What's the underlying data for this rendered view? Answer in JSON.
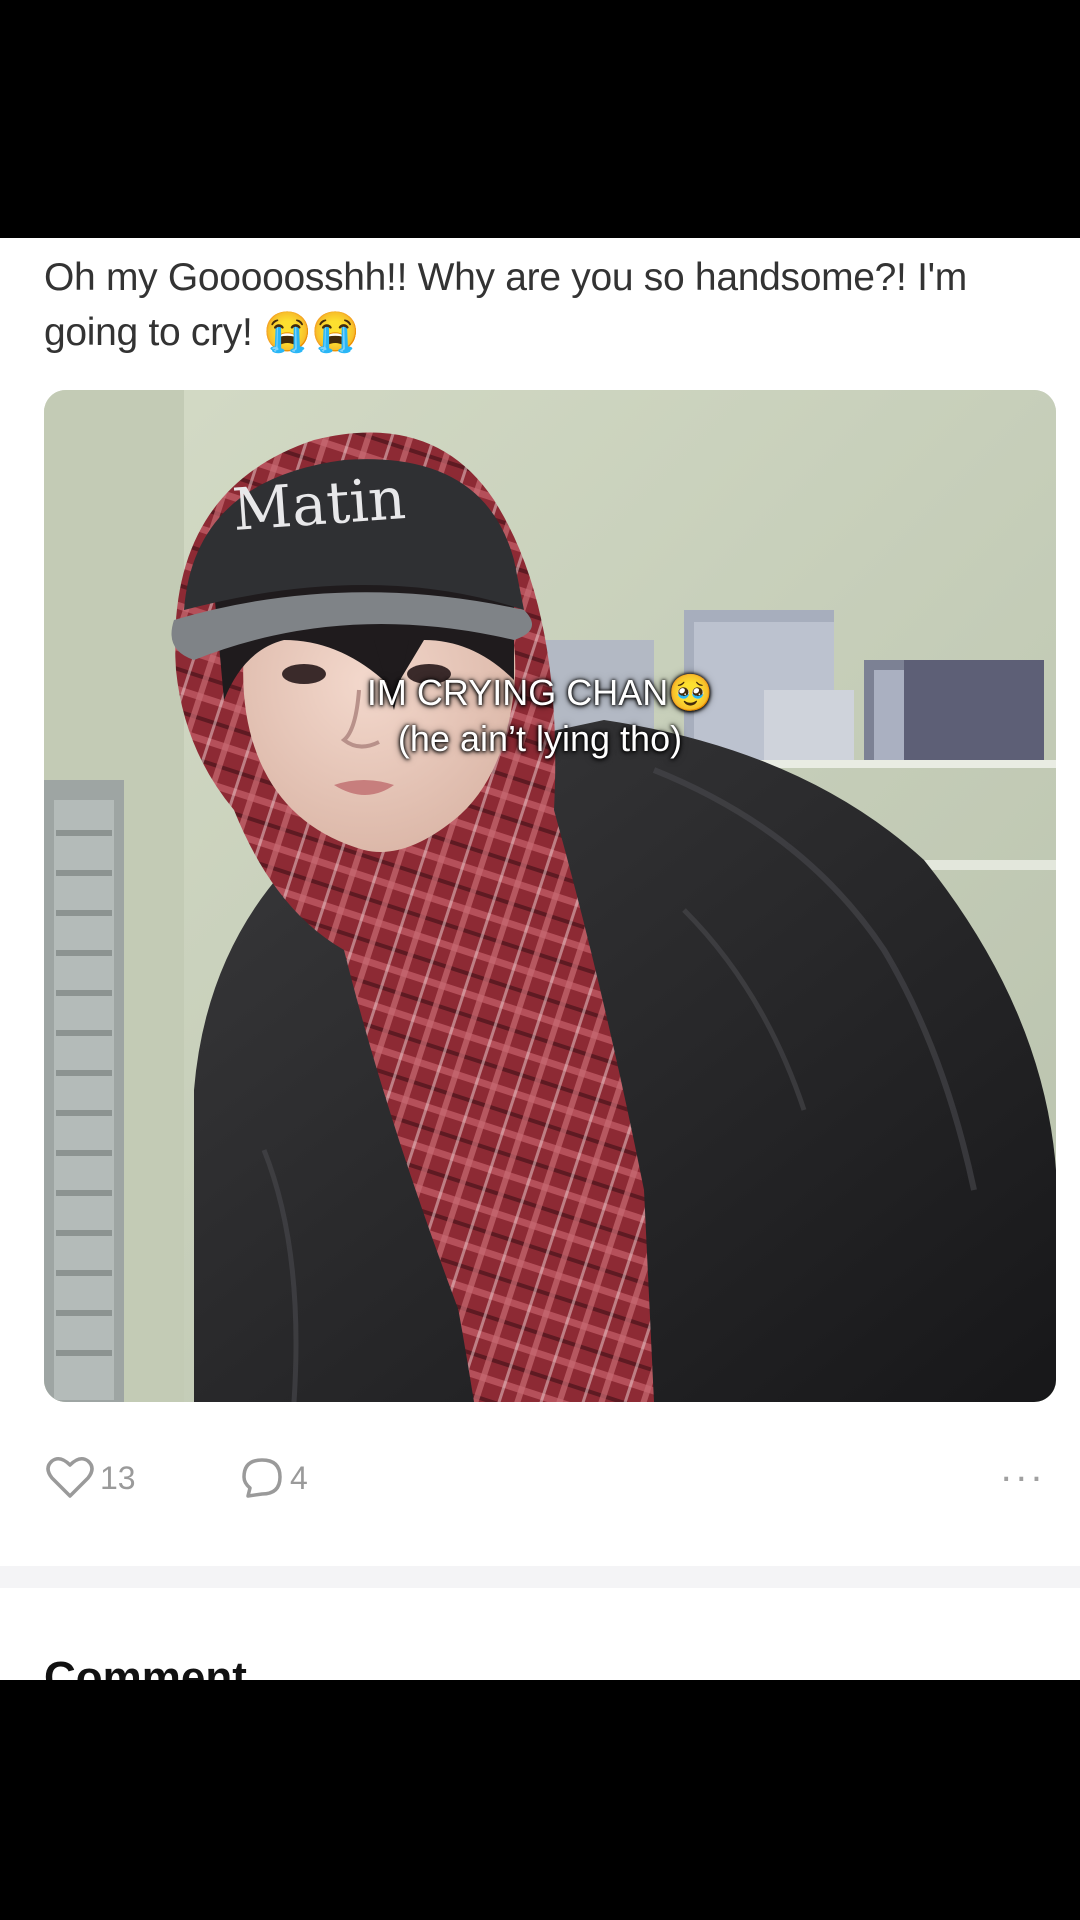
{
  "post": {
    "text": "Oh my Gooooosshh!! Why are you so handsome?! I'm going to cry! 😭😭",
    "photo": {
      "cap_logo": "Matin"
    },
    "overlay_caption": {
      "line1": "IM CRYING CHAN🥹",
      "line2": "(he ain’t lying tho)"
    },
    "actions": {
      "like_count": "13",
      "comment_count": "4",
      "more_label": "..."
    }
  },
  "section": {
    "heading": "Comment"
  },
  "colors": {
    "background": "#000000",
    "card": "#ffffff",
    "text": "#333333",
    "muted": "#9a9a9a"
  }
}
